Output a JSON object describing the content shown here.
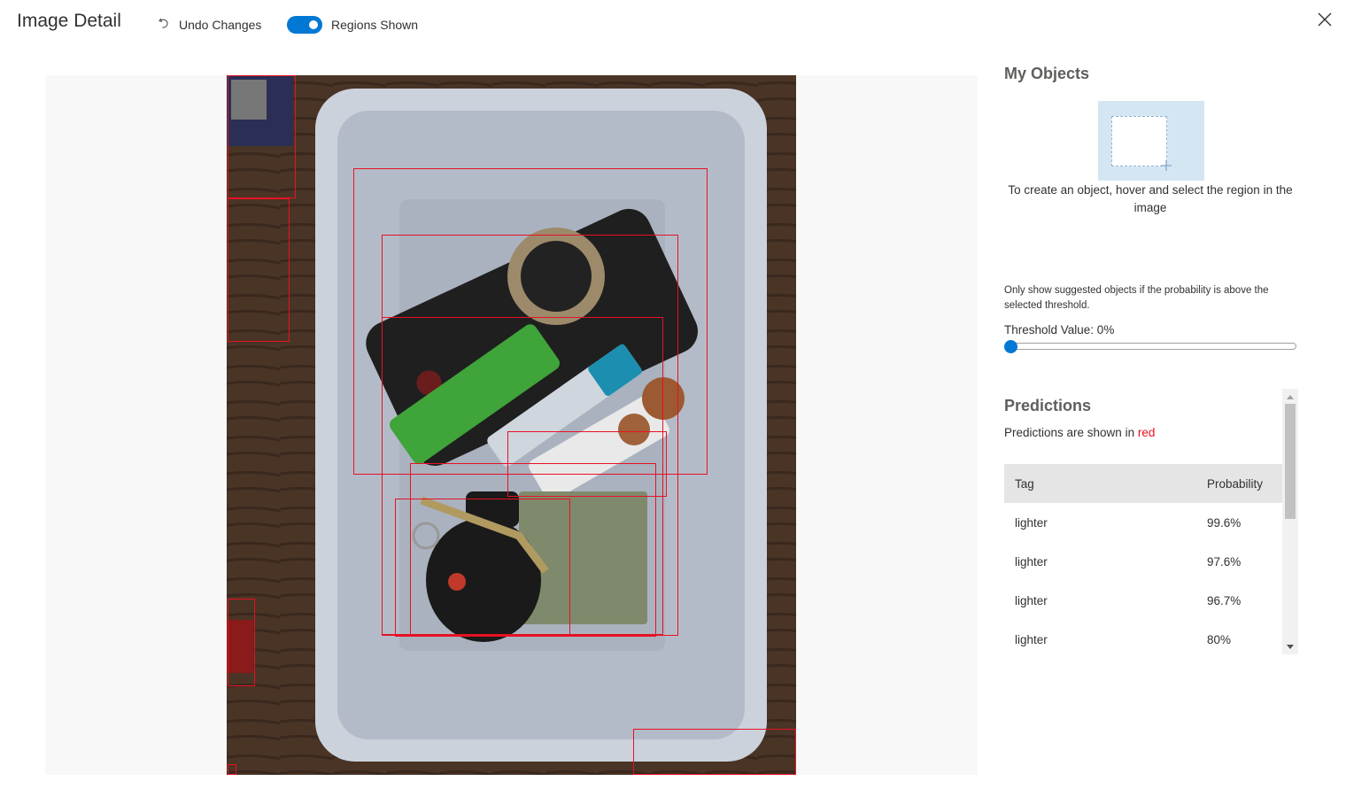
{
  "header": {
    "title": "Image Detail",
    "undo_label": "Undo Changes",
    "regions_toggle_label": "Regions Shown",
    "regions_toggle_on": true
  },
  "icons": {
    "undo": "undo-icon",
    "close": "close-icon",
    "add_region": "add-region-icon"
  },
  "colors": {
    "accent": "#0078d4",
    "region": "#e81123",
    "tile": "#d5e6f3"
  },
  "my_objects": {
    "title": "My Objects",
    "hint": "To create an object, hover and select the region in the image"
  },
  "threshold": {
    "note": "Only show suggested objects if the probability is above the selected threshold.",
    "label": "Threshold Value: 0%",
    "value": 0
  },
  "predictions": {
    "title": "Predictions",
    "subtitle_prefix": "Predictions are shown in ",
    "subtitle_color_word": "red",
    "columns": [
      "Tag",
      "Probability"
    ],
    "rows": [
      {
        "tag": "lighter",
        "probability": "99.6%"
      },
      {
        "tag": "lighter",
        "probability": "97.6%"
      },
      {
        "tag": "lighter",
        "probability": "96.7%"
      },
      {
        "tag": "lighter",
        "probability": "80%"
      }
    ]
  }
}
